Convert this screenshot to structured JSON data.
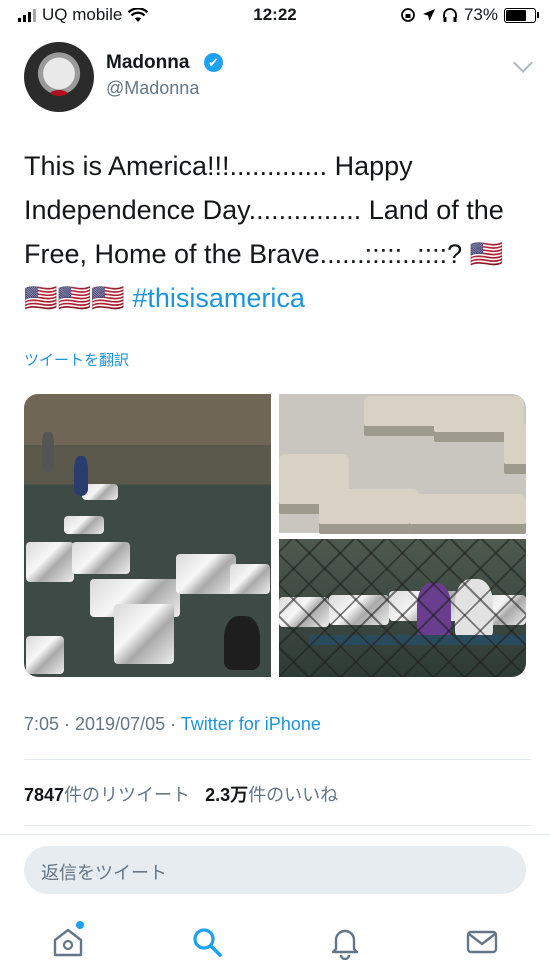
{
  "status_bar": {
    "carrier": "UQ mobile",
    "time": "12:22",
    "battery": "73%",
    "battery_level": 0.73
  },
  "tweet": {
    "author": {
      "name": "Madonna",
      "handle": "@Madonna",
      "verified_icon": "✔"
    },
    "text_main": "This is America!!!............. Happy Independence Day............... Land of the Free, Home of the Brave......:::::..::::? 🇺🇸 🇺🇸🇺🇸🇺🇸 ",
    "hashtag": "#thisisamerica",
    "translate_label": "ツイートを翻訳",
    "timestamp": "7:05 · 2019/07/05 · ",
    "source": "Twitter for iPhone",
    "retweets_count": "7847",
    "retweets_label": "件のリツイート",
    "likes_count": "2.3万",
    "likes_label": "件のいいね"
  },
  "reply": {
    "placeholder": "返信をツイート"
  },
  "tabbar": {
    "items": [
      "home-icon",
      "search-icon",
      "notifications-icon",
      "messages-icon"
    ]
  },
  "colors": {
    "accent": "#1da1f2",
    "link": "#1b95e0",
    "secondary_text": "#657786"
  }
}
